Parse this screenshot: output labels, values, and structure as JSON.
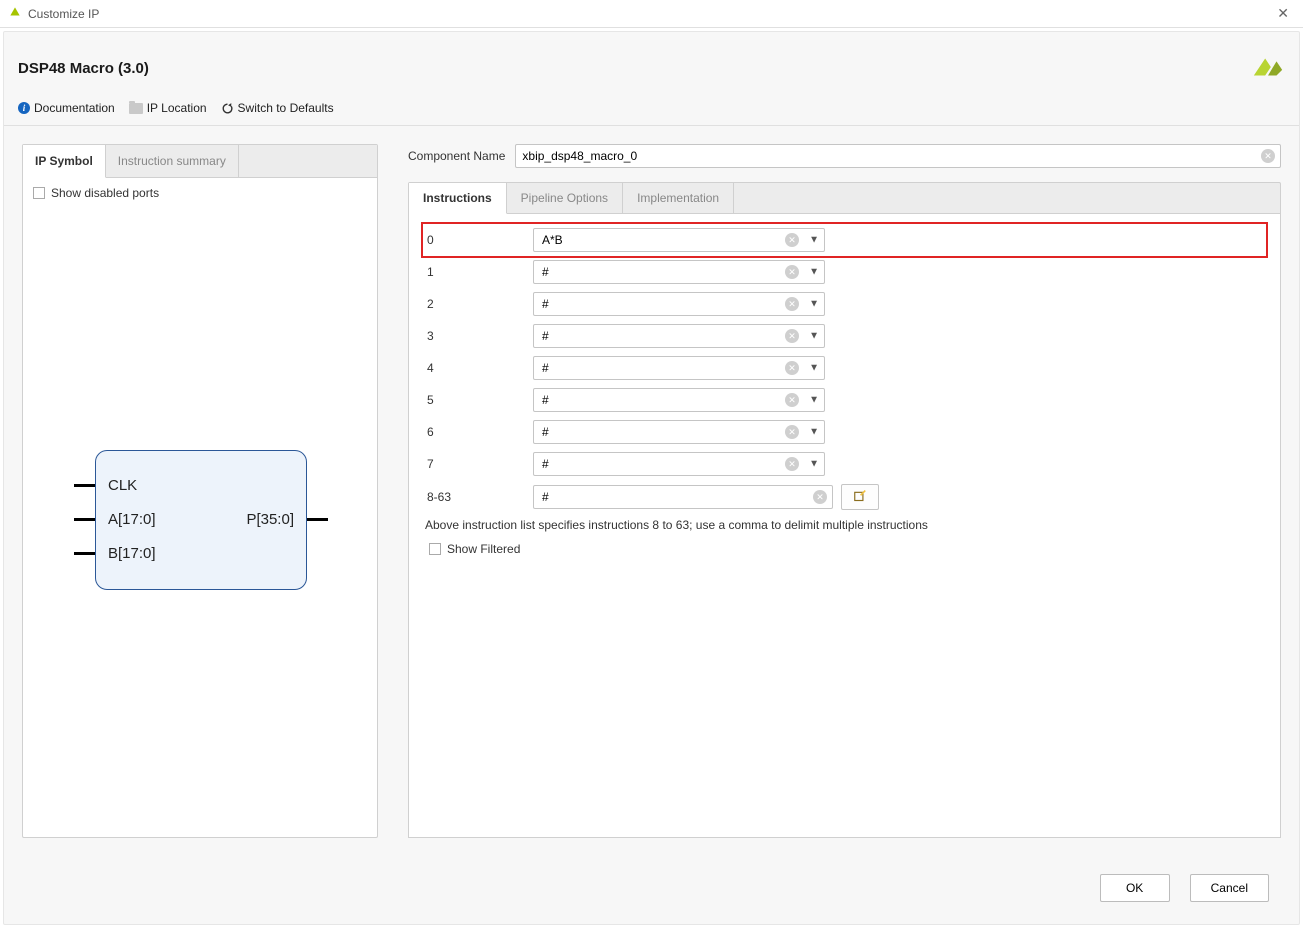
{
  "window": {
    "title": "Customize IP"
  },
  "header": {
    "title": "DSP48 Macro (3.0)"
  },
  "toolbar": {
    "doc": "Documentation",
    "iploc": "IP Location",
    "defaults": "Switch to Defaults"
  },
  "left": {
    "tabs": {
      "symbol": "IP Symbol",
      "summary": "Instruction summary"
    },
    "show_disabled": "Show disabled ports",
    "ports": {
      "clk": "CLK",
      "a": "A[17:0]",
      "b": "B[17:0]",
      "p": "P[35:0]"
    }
  },
  "right": {
    "comp_label": "Component Name",
    "comp_value": "xbip_dsp48_macro_0",
    "tabs": {
      "instructions": "Instructions",
      "pipeline": "Pipeline Options",
      "impl": "Implementation"
    },
    "instructions": [
      {
        "idx": "0",
        "val": "A*B"
      },
      {
        "idx": "1",
        "val": "#"
      },
      {
        "idx": "2",
        "val": "#"
      },
      {
        "idx": "3",
        "val": "#"
      },
      {
        "idx": "4",
        "val": "#"
      },
      {
        "idx": "5",
        "val": "#"
      },
      {
        "idx": "6",
        "val": "#"
      },
      {
        "idx": "7",
        "val": "#"
      }
    ],
    "bulk": {
      "idx": "8-63",
      "val": "#"
    },
    "hint": "Above instruction list specifies instructions 8 to 63; use a comma to delimit multiple instructions",
    "show_filtered": "Show Filtered"
  },
  "footer": {
    "ok": "OK",
    "cancel": "Cancel"
  }
}
